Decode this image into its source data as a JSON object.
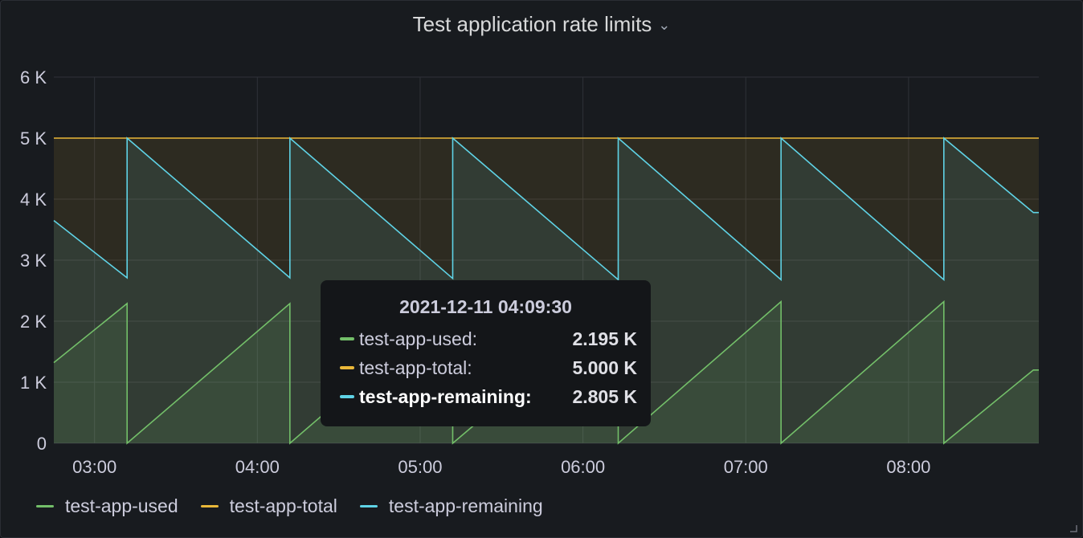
{
  "panel": {
    "title": "Test application rate limits",
    "title_menu_icon": "chevron-down-icon"
  },
  "chart_data": {
    "type": "area",
    "title": "Test application rate limits",
    "xlabel": "",
    "ylabel": "",
    "x_ticks": [
      "03:00",
      "04:00",
      "05:00",
      "06:00",
      "07:00",
      "08:00"
    ],
    "x_range": [
      "02:45",
      "08:48"
    ],
    "y_ticks": [
      "0",
      "1 K",
      "2 K",
      "3 K",
      "4 K",
      "5 K",
      "6 K"
    ],
    "ylim": [
      0,
      6000
    ],
    "grid": true,
    "legend_position": "bottom-left",
    "series": [
      {
        "name": "test-app-used",
        "color": "#73bf69",
        "fill": true,
        "points": [
          [
            "02:45",
            1320
          ],
          [
            "03:12",
            2290
          ],
          [
            "03:12",
            0
          ],
          [
            "04:12",
            2290
          ],
          [
            "04:12",
            0
          ],
          [
            "05:12",
            2300
          ],
          [
            "05:12",
            0
          ],
          [
            "06:13",
            2300
          ],
          [
            "06:13",
            0
          ],
          [
            "07:13",
            2320
          ],
          [
            "07:13",
            0
          ],
          [
            "08:13",
            2320
          ],
          [
            "08:13",
            0
          ],
          [
            "08:46",
            1200
          ],
          [
            "08:48",
            1200
          ]
        ]
      },
      {
        "name": "test-app-total",
        "color": "#fade2a",
        "fill": true,
        "points": [
          [
            "02:45",
            5000
          ],
          [
            "08:48",
            5000
          ]
        ]
      },
      {
        "name": "test-app-remaining",
        "color": "#8ab8ff",
        "stroke": "#5fd3e6",
        "fill": true,
        "points": [
          [
            "02:45",
            3650
          ],
          [
            "03:12",
            2710
          ],
          [
            "03:12",
            5000
          ],
          [
            "04:12",
            2710
          ],
          [
            "04:12",
            5000
          ],
          [
            "05:12",
            2700
          ],
          [
            "05:12",
            5000
          ],
          [
            "06:13",
            2680
          ],
          [
            "06:13",
            5000
          ],
          [
            "07:13",
            2680
          ],
          [
            "07:13",
            5000
          ],
          [
            "08:13",
            2680
          ],
          [
            "08:13",
            5000
          ],
          [
            "08:46",
            3780
          ],
          [
            "08:48",
            3780
          ]
        ]
      }
    ]
  },
  "tooltip": {
    "time": "2021-12-11 04:09:30",
    "rows": [
      {
        "label": "test-app-used:",
        "value": "2.195 K",
        "color": "#73bf69",
        "highlight": false
      },
      {
        "label": "test-app-total:",
        "value": "5.000 K",
        "color": "#fade2a",
        "highlight": false
      },
      {
        "label": "test-app-remaining:",
        "value": "2.805 K",
        "color": "#5fd3e6",
        "highlight": true
      }
    ]
  },
  "legend": {
    "items": [
      {
        "label": "test-app-used",
        "color": "#73bf69"
      },
      {
        "label": "test-app-total",
        "color": "#eab839"
      },
      {
        "label": "test-app-remaining",
        "color": "#5fd3e6"
      }
    ]
  }
}
